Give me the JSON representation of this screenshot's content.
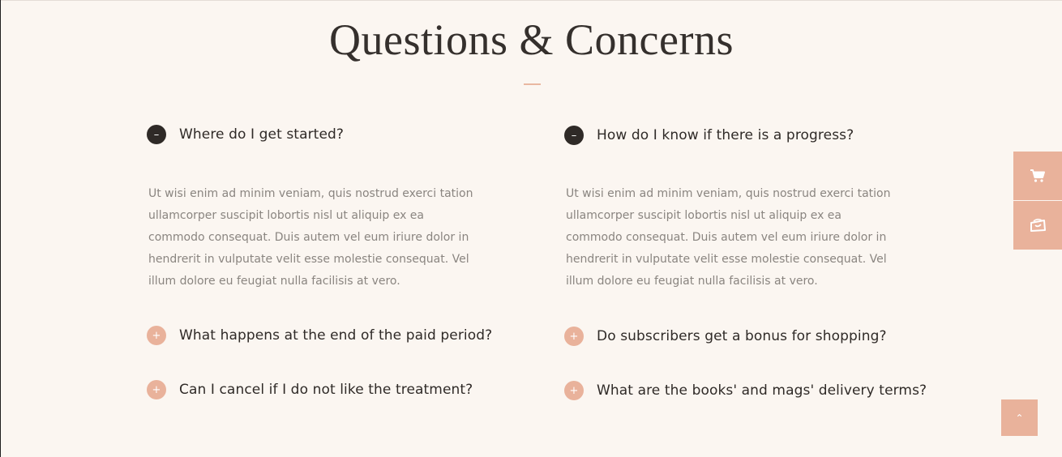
{
  "section": {
    "title": "Questions & Concerns"
  },
  "faq": {
    "left": [
      {
        "question": "Where do I get started?",
        "expanded": true,
        "answer": "Ut wisi enim ad minim veniam, quis nostrud exerci tation ullamcorper suscipit lobortis nisl ut aliquip ex ea commodo consequat. Duis autem vel eum iriure dolor in hendrerit in vulputate velit esse molestie consequat. Vel illum dolore eu feugiat nulla facilisis at vero."
      },
      {
        "question": "What happens at the end of the paid period?",
        "expanded": false
      },
      {
        "question": "Can I cancel if I do not like the treatment?",
        "expanded": false
      }
    ],
    "right": [
      {
        "question": "How do I know if there is a progress?",
        "expanded": true,
        "answer": "Ut wisi enim ad minim veniam, quis nostrud exerci tation ullamcorper suscipit lobortis nisl ut aliquip ex ea commodo consequat. Duis autem vel eum iriure dolor in hendrerit in vulputate velit esse molestie consequat. Vel illum dolore eu feugiat nulla facilisis at vero."
      },
      {
        "question": "Do subscribers get a bonus for shopping?",
        "expanded": false
      },
      {
        "question": "What are the books' and mags' delivery terms?",
        "expanded": false
      }
    ]
  },
  "icons": {
    "open_toggle": "minus-icon",
    "closed_toggle": "plus-icon",
    "side_cart": "cart-icon",
    "side_deals": "shopping-bag-icon",
    "scroll_top": "chevron-up-icon"
  },
  "glyphs": {
    "minus": "–",
    "plus": "+",
    "chevron_up": "⌃"
  },
  "colors": {
    "background": "#fbf6f1",
    "accent": "#e9b29b",
    "dark": "#2f2a27",
    "body_text": "#8a8580"
  }
}
